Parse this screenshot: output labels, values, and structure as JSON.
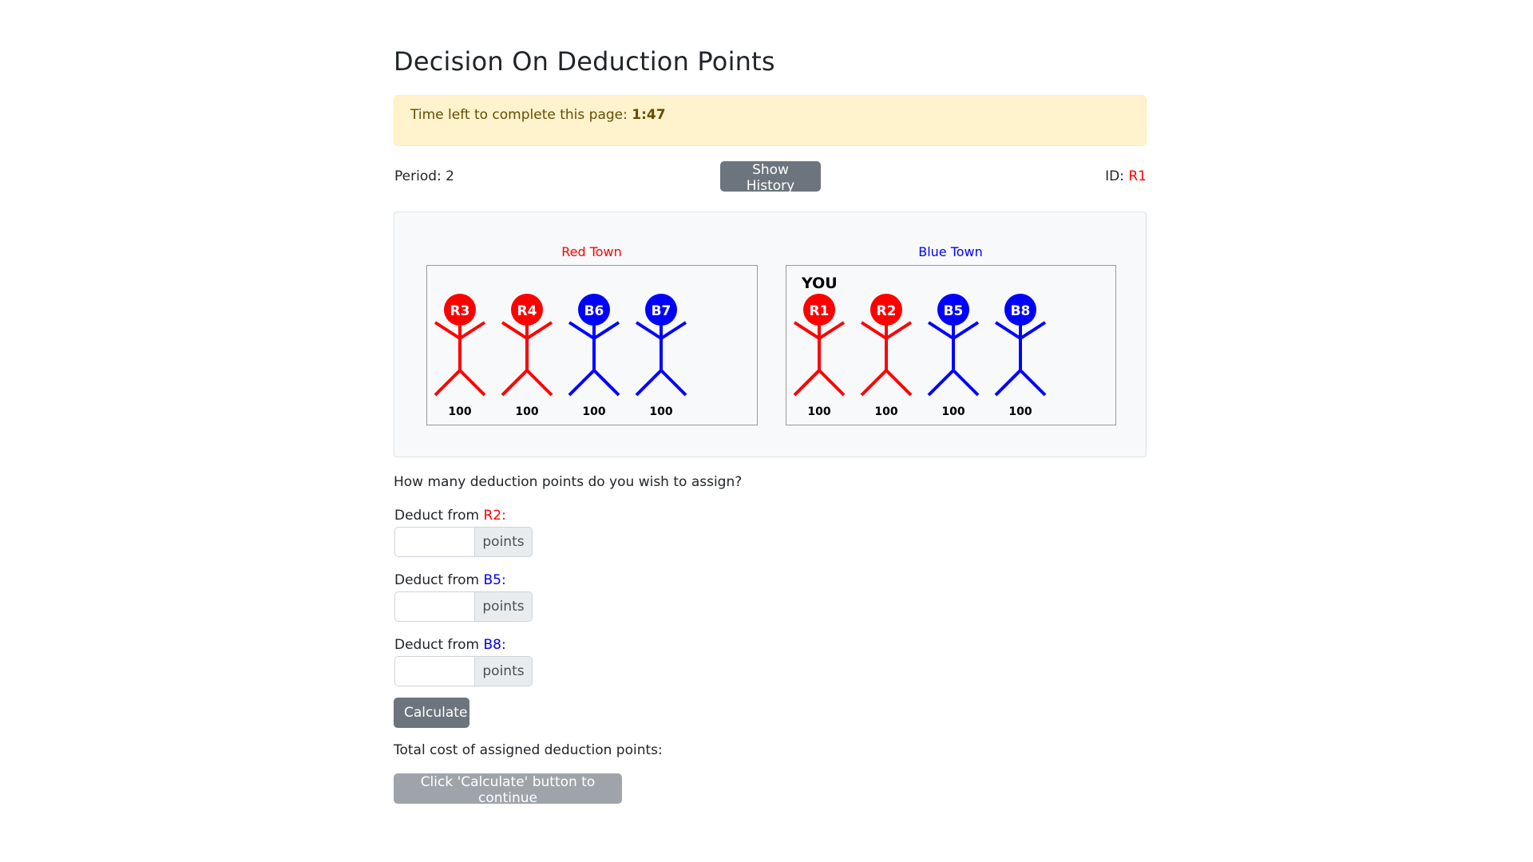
{
  "page": {
    "title": "Decision On Deduction Points"
  },
  "timer": {
    "label": "Time left to complete this page:",
    "value": "1:47"
  },
  "info": {
    "period_label": "Period:",
    "period_value": "2",
    "show_history_label": "Show History",
    "id_label": "ID:",
    "id_value": "R1"
  },
  "towns": [
    {
      "name": "Red Town",
      "name_color": "#ff0000",
      "you_label": "",
      "members": [
        {
          "id": "R3",
          "color": "#ff0000",
          "points": "100"
        },
        {
          "id": "R4",
          "color": "#ff0000",
          "points": "100"
        },
        {
          "id": "B6",
          "color": "#0000ff",
          "points": "100"
        },
        {
          "id": "B7",
          "color": "#0000ff",
          "points": "100"
        }
      ]
    },
    {
      "name": "Blue Town",
      "name_color": "#0000ff",
      "you_label": "YOU",
      "members": [
        {
          "id": "R1",
          "color": "#ff0000",
          "points": "100"
        },
        {
          "id": "R2",
          "color": "#ff0000",
          "points": "100"
        },
        {
          "id": "B5",
          "color": "#0000ff",
          "points": "100"
        },
        {
          "id": "B8",
          "color": "#0000ff",
          "points": "100"
        }
      ]
    }
  ],
  "form": {
    "question": "How many deduction points do you wish to assign?",
    "deductions": [
      {
        "prefix": "Deduct from",
        "target": "R2:",
        "color": "#ff0000",
        "value": "",
        "suffix": "points"
      },
      {
        "prefix": "Deduct from",
        "target": "B5:",
        "color": "#0000ee",
        "value": "",
        "suffix": "points"
      },
      {
        "prefix": "Deduct from",
        "target": "B8:",
        "color": "#0000ee",
        "value": "",
        "suffix": "points"
      }
    ],
    "calculate_label": "Calculate",
    "total_cost_label": "Total cost of assigned deduction points:",
    "continue_label": "Click 'Calculate' button to continue"
  },
  "colors": {
    "red": "#ff0000",
    "blue": "#0000ff",
    "secondary_button": "#6c757d",
    "warning_bg": "#fff3cd"
  }
}
